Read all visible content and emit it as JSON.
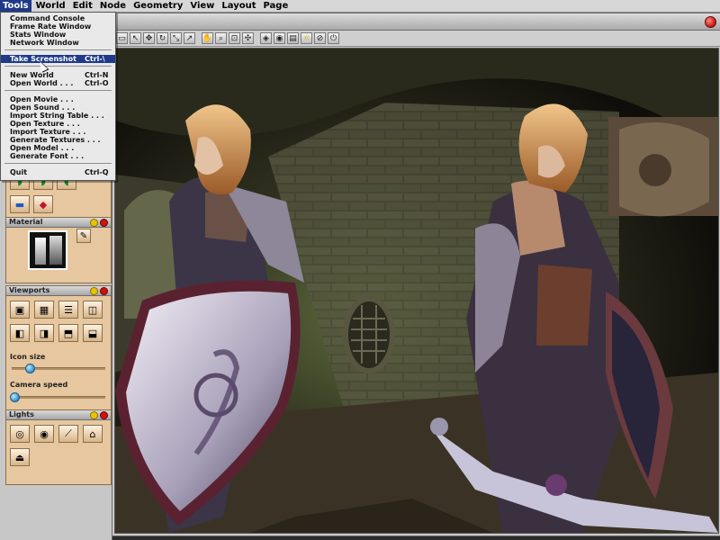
{
  "menubar": {
    "items": [
      "Tools",
      "World",
      "Edit",
      "Node",
      "Geometry",
      "View",
      "Layout",
      "Page"
    ]
  },
  "tools_menu": {
    "items": [
      {
        "label": "Command Console",
        "shortcut": ""
      },
      {
        "label": "Frame Rate Window",
        "shortcut": ""
      },
      {
        "label": "Stats Window",
        "shortcut": ""
      },
      {
        "label": "Network Window",
        "shortcut": ""
      },
      {
        "label": "Take Screenshot",
        "shortcut": "Ctrl-\\"
      },
      {
        "label": "New World",
        "shortcut": "Ctrl-N"
      },
      {
        "label": "Open World . . .",
        "shortcut": "Ctrl-O"
      },
      {
        "label": "Open Movie . . .",
        "shortcut": ""
      },
      {
        "label": "Open Sound . . .",
        "shortcut": ""
      },
      {
        "label": "Import String Table . . .",
        "shortcut": ""
      },
      {
        "label": "Open Texture . . .",
        "shortcut": ""
      },
      {
        "label": "Import Texture . . .",
        "shortcut": ""
      },
      {
        "label": "Generate Textures . . .",
        "shortcut": ""
      },
      {
        "label": "Open Model . . .",
        "shortcut": ""
      },
      {
        "label": "Generate Font . . .",
        "shortcut": ""
      },
      {
        "label": "Quit",
        "shortcut": "Ctrl-Q"
      }
    ]
  },
  "panels": {
    "material": {
      "title": "Material"
    },
    "viewports": {
      "title": "Viewports",
      "icon_size_label": "Icon size",
      "camera_speed_label": "Camera speed",
      "icon_size_value": 0.2,
      "camera_speed_value": 0.02
    },
    "lights": {
      "title": "Lights"
    }
  },
  "colors": {
    "menu_highlight": "#1f3a88",
    "panel_bg": "#e7c79f",
    "close_button": "#c21414"
  }
}
